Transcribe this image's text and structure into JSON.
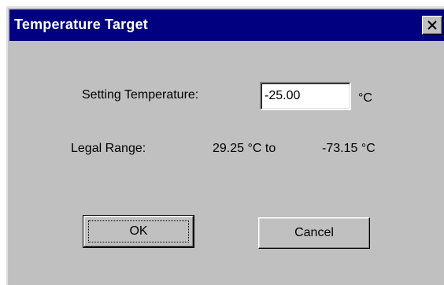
{
  "window": {
    "title": "Temperature Target"
  },
  "icons": {
    "close": "close-icon"
  },
  "form": {
    "setting_label": "Setting Temperature:",
    "setting_value": "-25.00",
    "unit": "°C",
    "legal_range_label": "Legal Range:",
    "range_low": "29.25 °C to",
    "range_high": "-73.15 °C"
  },
  "buttons": {
    "ok_label": "OK",
    "cancel_label": "Cancel"
  },
  "colors": {
    "titlebar": "#000080",
    "dialog_face": "#c0c0c0"
  }
}
